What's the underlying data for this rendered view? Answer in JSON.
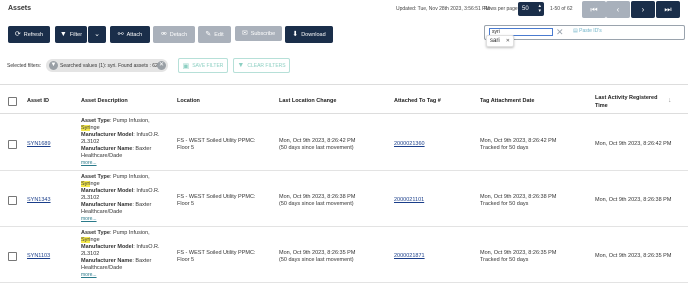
{
  "header": {
    "title": "Assets",
    "updated": "Updated: Tue, Nov 28th 2023, 3:56:51 PM",
    "rows_per_page_label": "Rows per page:",
    "rows_per_page_value": "50",
    "range": "1-50 of 62"
  },
  "toolbar": {
    "refresh": "Refresh",
    "filter": "Filter",
    "attach": "Attach",
    "detach": "Detach",
    "edit": "Edit",
    "subscribe": "Subscribe",
    "download": "Download",
    "rfid": "Paste ID's"
  },
  "search": {
    "value": "syri",
    "suggestion": "sari"
  },
  "filters": {
    "label": "Selected filters:",
    "chip": "Searched values (1): syri. Found assets : 62",
    "save": "SAVE FILTER",
    "clear": "CLEAR FILTERS"
  },
  "table": {
    "columns": [
      "Asset ID",
      "Asset Description",
      "Location",
      "Last Location Change",
      "Attached To Tag #",
      "Tag Attachment Date",
      "Last Activity Registered Time"
    ],
    "desc_labels": {
      "type": "Asset Type",
      "model": "Manufacturer Model",
      "name": "Manufacturer Name",
      "more": "more..."
    },
    "rows": [
      {
        "id": "SYN1689",
        "type_pre": ": Pump Infusion,",
        "type_hl": "Syri",
        "type_post": "nge",
        "model": ": InfusO.R.",
        "model2": "2L3102",
        "name": ": Baxter",
        "name2": "Healthcare/Dade",
        "loc1": "FS - WEST Soiled Utility PPMC:",
        "loc2": "Floor 5",
        "change1": "Mon, Oct 9th 2023, 8:26:42 PM",
        "change2": "(50 days since last movement)",
        "tag": "2000021360",
        "att1": "Mon, Oct 9th 2023, 8:26:42 PM",
        "att2": "Tracked for 50 days",
        "activity": "Mon, Oct 9th 2023, 8:26:42 PM"
      },
      {
        "id": "SYN1343",
        "type_pre": ": Pump Infusion,",
        "type_hl": "Syri",
        "type_post": "nge",
        "model": ": InfusO.R.",
        "model2": "2L3102",
        "name": ": Baxter",
        "name2": "Healthcare/Dade",
        "loc1": "FS - WEST Soiled Utility PPMC:",
        "loc2": "Floor 5",
        "change1": "Mon, Oct 9th 2023, 8:26:38 PM",
        "change2": "(50 days since last movement)",
        "tag": "2000021101",
        "att1": "Mon, Oct 9th 2023, 8:26:38 PM",
        "att2": "Tracked for 50 days",
        "activity": "Mon, Oct 9th 2023, 8:26:38 PM"
      },
      {
        "id": "SYN1103",
        "type_pre": ": Pump Infusion,",
        "type_hl": "Syri",
        "type_post": "nge",
        "model": ": InfusO.R.",
        "model2": "2L3102",
        "name": ": Baxter",
        "name2": "Healthcare/Dade",
        "loc1": "FS - WEST Soiled Utility PPMC:",
        "loc2": "Floor 5",
        "change1": "Mon, Oct 9th 2023, 8:26:35 PM",
        "change2": "(50 days since last movement)",
        "tag": "2000021871",
        "att1": "Mon, Oct 9th 2023, 8:26:35 PM",
        "att2": "Tracked for 50 days",
        "activity": "Mon, Oct 9th 2023, 8:26:35 PM"
      }
    ]
  }
}
